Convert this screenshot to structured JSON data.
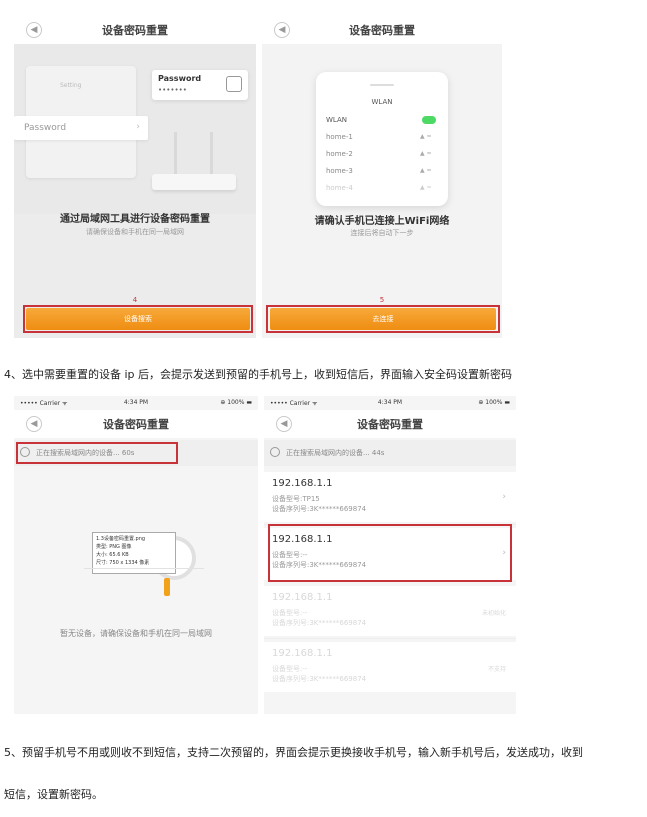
{
  "panel1": {
    "nav_title": "设备密码重置",
    "back_glyph": "◀",
    "card_label": "Password",
    "field_label": "Password",
    "card_setting": "Setting",
    "dots": "•••••••",
    "heading": "通过局域网工具进行设备密码重置",
    "subtext": "请确保设备和手机在同一局域网",
    "step_no": "4",
    "button": "设备搜索"
  },
  "panel2": {
    "nav_title": "设备密码重置",
    "back_glyph": "◀",
    "wlan_title": "WLAN",
    "wlan_label": "WLAN",
    "networks": [
      "home-1",
      "home-2",
      "home-3",
      "home-4"
    ],
    "heading": "请确认手机已连接上WiFi网络",
    "subtext": "连接后将自动下一步",
    "step_no": "5",
    "button": "去连接"
  },
  "caption1": "4、选中需要重置的设备 ip 后，会提示发送到预留的手机号上，收到短信后，界面输入安全码设置新密码",
  "panel3": {
    "status_carrier": "••••• Carrier ᯤ",
    "status_time": "4:34 PM",
    "status_battery": "⊕ 100% ▬",
    "nav_title": "设备密码重置",
    "back_glyph": "◀",
    "searching": "正在搜索局域网内的设备... 60s",
    "file_name": "1.3设备密码重置.png",
    "file_type": "类型: PNG 图像",
    "file_size": "大小: 65.6 KB",
    "file_dims": "尺寸: 750 x 1334 像素",
    "empty_text": "暂无设备，请确保设备和手机在同一局域网"
  },
  "panel4": {
    "status_carrier": "••••• Carrier ᯤ",
    "status_time": "4:34 PM",
    "status_battery": "⊕ 100% ▬",
    "nav_title": "设备密码重置",
    "back_glyph": "◀",
    "searching": "正在搜索局域网内的设备... 44s",
    "devices": [
      {
        "ip": "192.168.1.1",
        "model": "设备型号:TP15",
        "serial": "设备序列号:3K******669874",
        "tag": ""
      },
      {
        "ip": "192.168.1.1",
        "model": "设备型号:--",
        "serial": "设备序列号:3K******669874",
        "tag": ""
      },
      {
        "ip": "192.168.1.1",
        "model": "设备型号:--",
        "serial": "设备序列号:3K******669874",
        "tag": "未初始化"
      },
      {
        "ip": "192.168.1.1",
        "model": "设备型号:--",
        "serial": "设备序列号:3K******669874",
        "tag": "不支持"
      }
    ]
  },
  "caption2_line1": "5、预留手机号不用或则收不到短信，支持二次预留的，界面会提示更换接收手机号，输入新手机号后，发送成功，收到",
  "caption2_line2": "短信，设置新密码。",
  "colors": {
    "accent": "#ef8d12",
    "highlight": "#c8333a",
    "toggle": "#4cd964"
  }
}
